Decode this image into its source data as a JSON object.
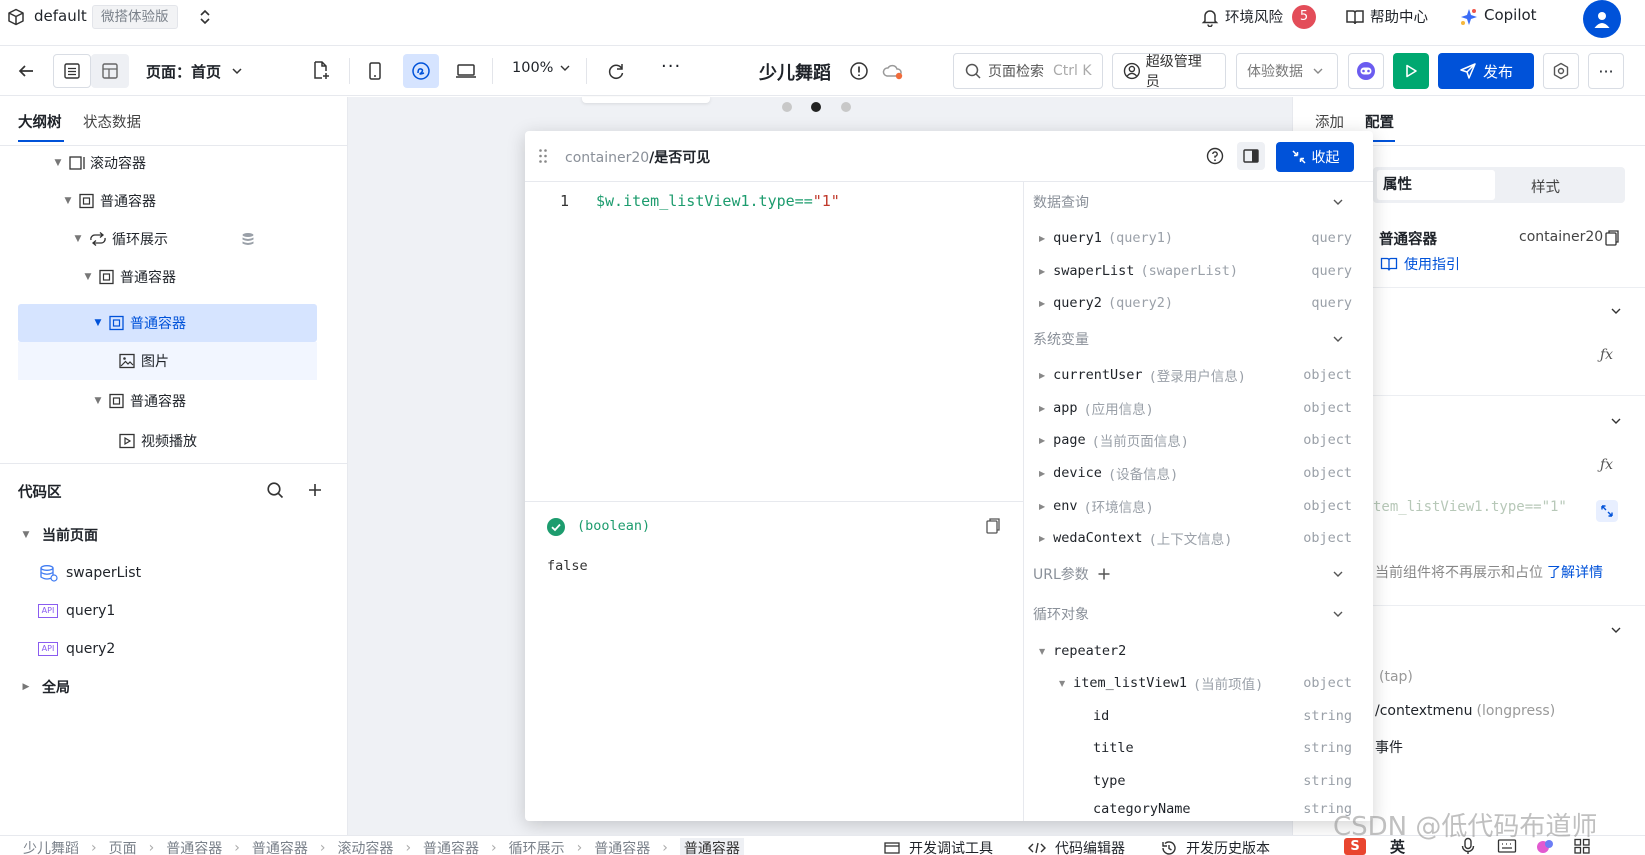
{
  "topbar": {
    "env_name": "default",
    "edition_badge": "微搭体验版",
    "env_risk_label": "环境风险",
    "env_risk_count": "5",
    "help_label": "帮助中心",
    "copilot_label": "Copilot"
  },
  "toolbar": {
    "page_select": "页面：首页",
    "zoom": "100%",
    "app_title": "少儿舞蹈",
    "search_label": "页面检索",
    "search_shortcut": "Ctrl K",
    "admin_label": "超级管理员",
    "data_select": "体验数据",
    "publish_label": "发布"
  },
  "left": {
    "tabs": [
      "大纲树",
      "状态数据"
    ],
    "tree": [
      {
        "label": "滚动容器"
      },
      {
        "label": "普通容器"
      },
      {
        "label": "循环展示"
      },
      {
        "label": "普通容器"
      },
      {
        "label": "普通容器"
      },
      {
        "label": "图片"
      },
      {
        "label": "普通容器"
      },
      {
        "label": "视频播放"
      }
    ],
    "code_title": "代码区",
    "code_current_page": "当前页面",
    "code_items": [
      "swaperList",
      "query1",
      "query2"
    ],
    "code_global": "全局"
  },
  "dialog": {
    "path_prefix": "container20",
    "path_name": "/是否可见",
    "collapse_label": "收起",
    "line_number": "1",
    "code": "$w.item_listView1.type==",
    "code_string": "\"1\"",
    "result_type": "(boolean)",
    "result_value": "false",
    "sections": {
      "data_query": "数据查询",
      "system_vars": "系统变量",
      "url_params": "URL参数",
      "loop_objects": "循环对象"
    },
    "queries": [
      {
        "name": "query1",
        "desc": "(query1)",
        "type": "query"
      },
      {
        "name": "swaperList",
        "desc": "(swaperList)",
        "type": "query"
      },
      {
        "name": "query2",
        "desc": "(query2)",
        "type": "query"
      }
    ],
    "system_vars": [
      {
        "name": "currentUser",
        "desc": "(登录用户信息)",
        "type": "object"
      },
      {
        "name": "app",
        "desc": "(应用信息)",
        "type": "object"
      },
      {
        "name": "page",
        "desc": "(当前页面信息)",
        "type": "object"
      },
      {
        "name": "device",
        "desc": "(设备信息)",
        "type": "object"
      },
      {
        "name": "env",
        "desc": "(环境信息)",
        "type": "object"
      },
      {
        "name": "wedaContext",
        "desc": "(上下文信息)",
        "type": "object"
      }
    ],
    "loop": {
      "repeater": "repeater2",
      "item": {
        "name": "item_listView1",
        "desc": "(当前项值)",
        "type": "object"
      },
      "fields": [
        {
          "name": "id",
          "type": "string"
        },
        {
          "name": "title",
          "type": "string"
        },
        {
          "name": "type",
          "type": "string"
        },
        {
          "name": "categoryName",
          "type": "string"
        }
      ]
    }
  },
  "right": {
    "tabs": [
      "添加",
      "配置"
    ],
    "subtabs": [
      "属性",
      "样式"
    ],
    "component_name": "普通容器",
    "component_id": "container20",
    "guide_link": "使用指引",
    "code_preview": "tem_listView1.type==\"1\"",
    "hint_text": "当前组件将不再展示和占位",
    "hint_link": "了解详情",
    "event_tap": "(tap)",
    "event_context": "/contextmenu",
    "event_longpress": "(longpress)",
    "event_label": "事件"
  },
  "bottom": {
    "breadcrumb": [
      "少儿舞蹈",
      "页面",
      "普通容器",
      "普通容器",
      "滚动容器",
      "普通容器",
      "循环展示",
      "普通容器",
      "普通容器"
    ],
    "dev_tools": "开发调试工具",
    "code_editor": "代码编辑器",
    "history": "开发历史版本",
    "watermark": "CSDN @低代码布道师",
    "ime_lang": "英"
  },
  "colors": {
    "primary": "#0052d9",
    "selected_bg": "#d6e4ff",
    "run_green": "#00a870",
    "danger": "#e34d59",
    "code_green": "#1d9c6e",
    "code_red": "#c0392b"
  }
}
